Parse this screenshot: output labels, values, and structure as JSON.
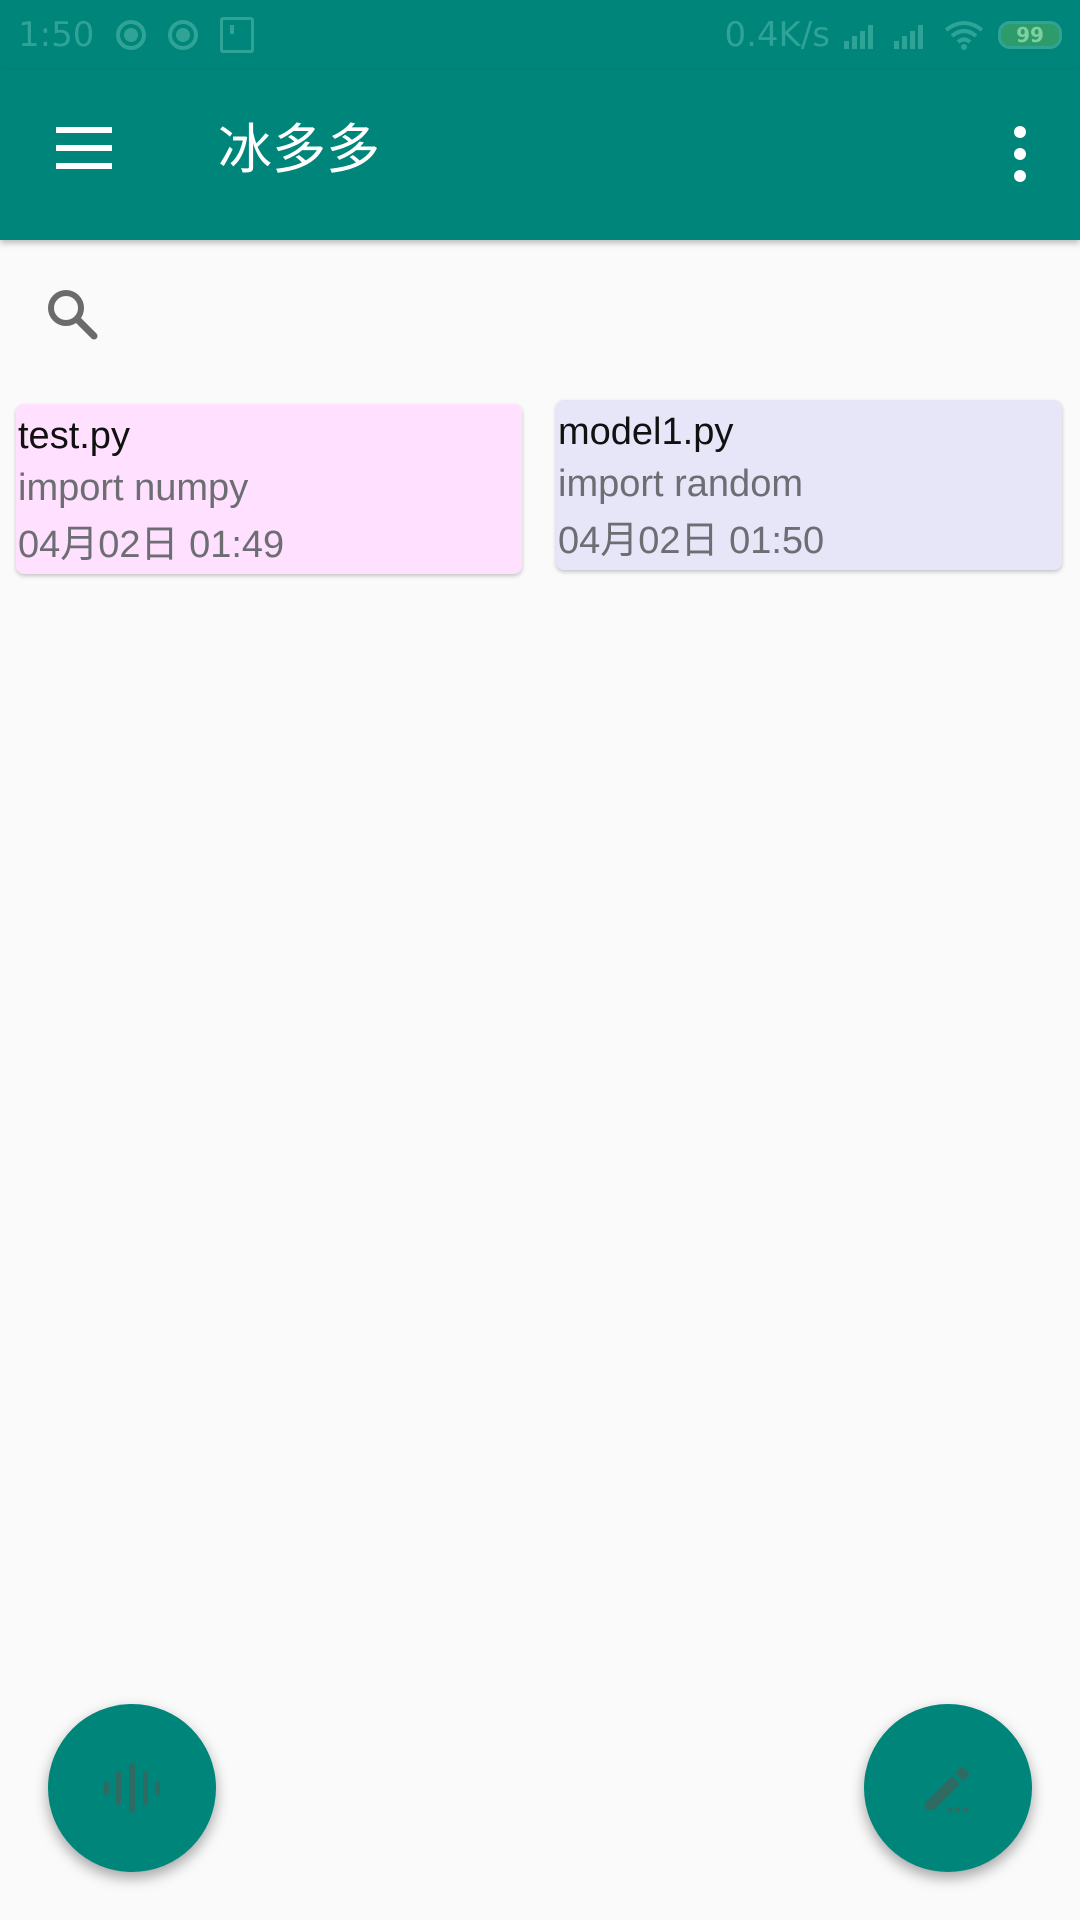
{
  "status_bar": {
    "time": "1:50",
    "net_speed": "0.4K/s",
    "battery": "99"
  },
  "app_bar": {
    "title": "冰多多",
    "menu_icon": "hamburger-menu-icon",
    "overflow_icon": "more-vert-icon"
  },
  "search": {
    "icon": "search-icon",
    "placeholder": ""
  },
  "notes": [
    {
      "title": "test.py",
      "body": "import numpy",
      "date": "04月02日 01:49",
      "color": "#ffe0fe"
    },
    {
      "title": "model1.py",
      "body": "import random",
      "date": "04月02日 01:50",
      "color": "#e6e6f8"
    }
  ],
  "fabs": {
    "voice_icon": "voice-waveform-icon",
    "edit_icon": "edit-pencil-icon"
  },
  "colors": {
    "primary": "#00857a",
    "background": "#fafafa"
  }
}
